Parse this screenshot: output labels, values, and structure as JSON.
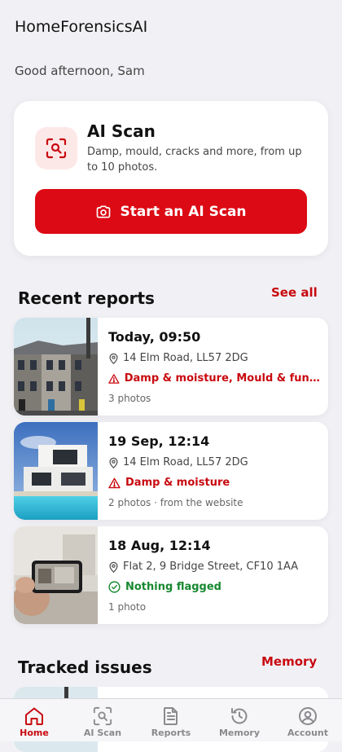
{
  "header": {
    "app_title": "HomeForensicsAI",
    "greeting": "Good afternoon, Sam"
  },
  "scan_card": {
    "title": "AI Scan",
    "description": "Damp, mould, cracks and more, from up to 10 photos.",
    "button_label": "Start an AI Scan",
    "icon": "scan-search-icon"
  },
  "recent_reports": {
    "title": "Recent reports",
    "link_label": "See all",
    "items": [
      {
        "date": "Today, 09:50",
        "address": "14 Elm Road, LL57 2DG",
        "issues": "Damp & moisture, Mould & fungal...",
        "status": "warning",
        "meta": "3 photos",
        "thumb": "terraced-houses"
      },
      {
        "date": "19 Sep, 12:14",
        "address": "14 Elm Road, LL57 2DG",
        "issues": "Damp & moisture",
        "status": "warning",
        "meta": "2 photos · from the website",
        "thumb": "modern-house-pool"
      },
      {
        "date": "18 Aug, 12:14",
        "address": "Flat 2, 9 Bridge Street, CF10 1AA",
        "issues": "Nothing flagged",
        "status": "ok",
        "meta": "1 photo",
        "thumb": "phone-photo"
      }
    ]
  },
  "tracked_issues": {
    "title": "Tracked issues",
    "link_label": "Memory"
  },
  "nav": {
    "items": [
      {
        "label": "Home",
        "icon": "home-icon",
        "active": true
      },
      {
        "label": "AI Scan",
        "icon": "scan-icon",
        "active": false
      },
      {
        "label": "Reports",
        "icon": "document-icon",
        "active": false
      },
      {
        "label": "Memory",
        "icon": "history-icon",
        "active": false
      },
      {
        "label": "Account",
        "icon": "account-icon",
        "active": false
      }
    ]
  },
  "colors": {
    "accent": "#dc0a14",
    "warning": "#c8090f",
    "ok": "#17882f",
    "background": "#f1f1f5"
  }
}
